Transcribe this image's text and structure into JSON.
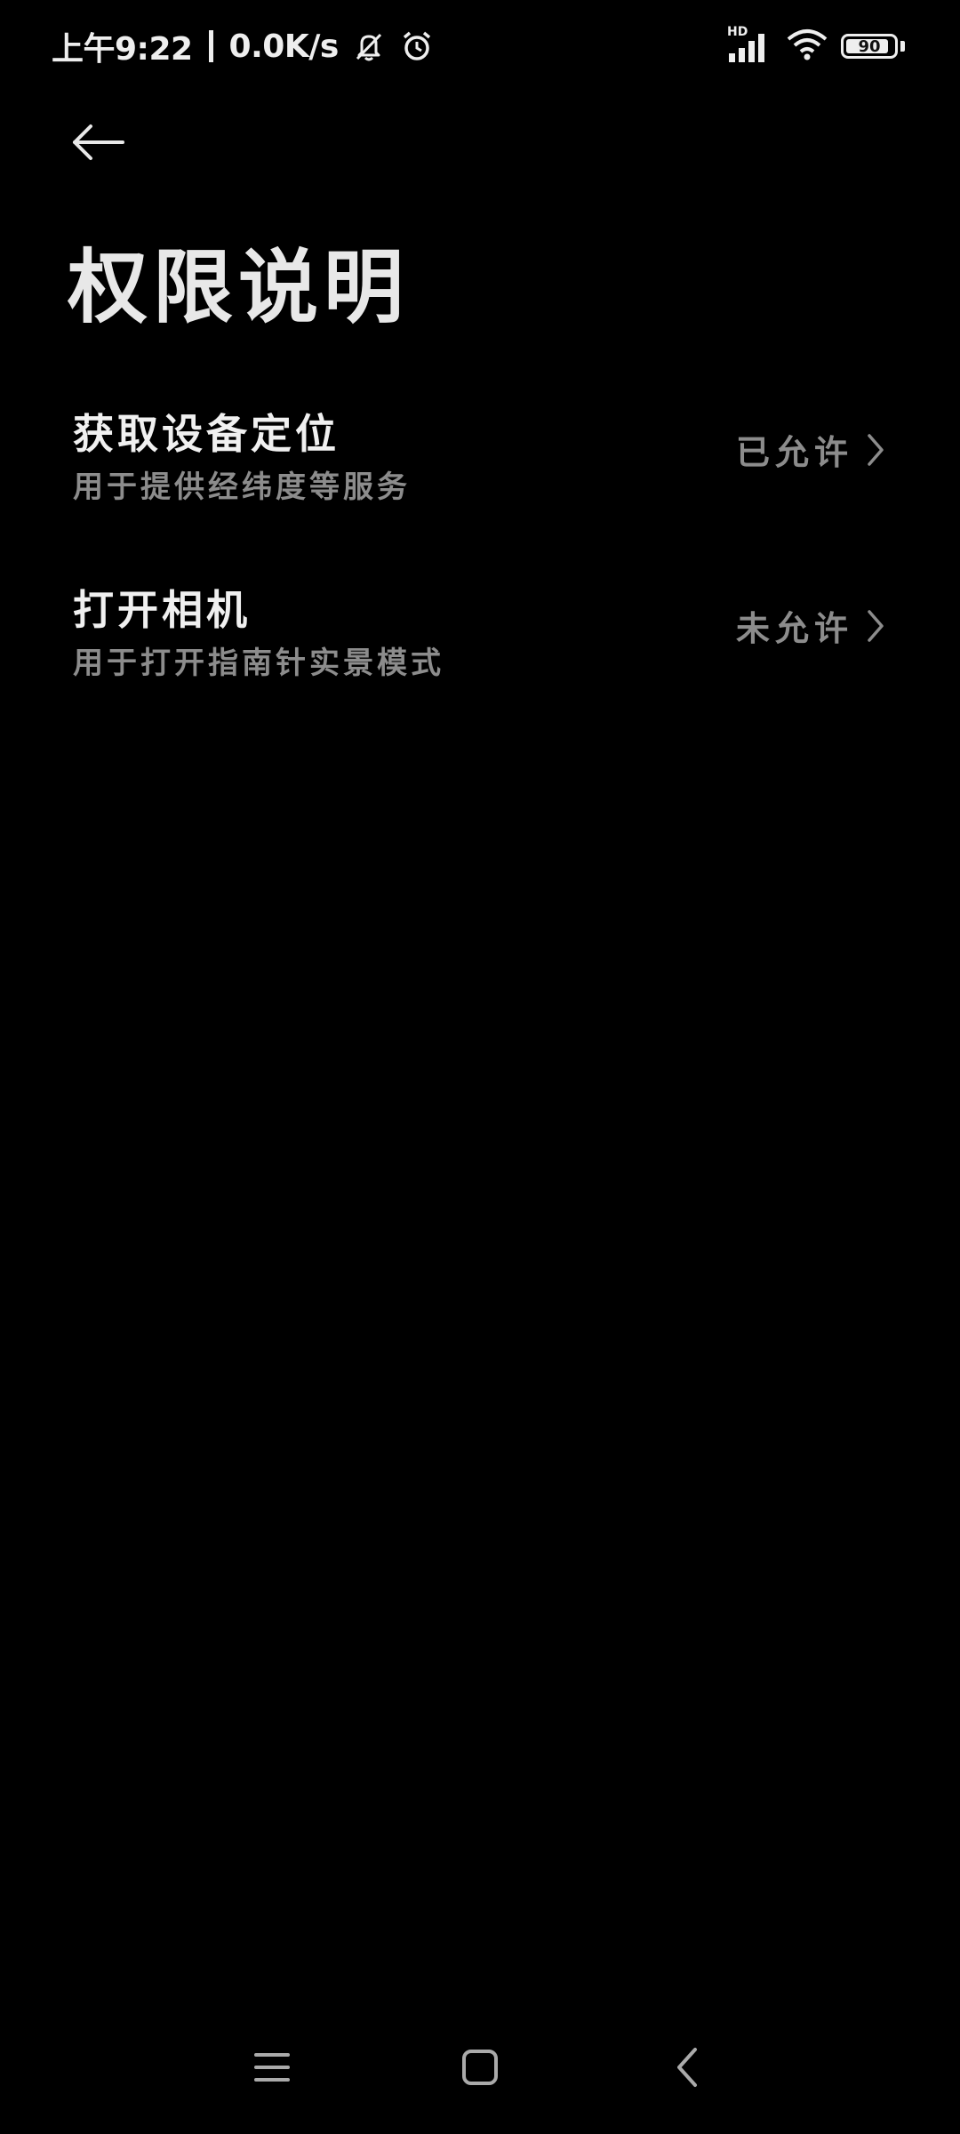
{
  "status_bar": {
    "time": "上午9:22",
    "network_speed": "0.0K/s",
    "signal_label": "HD",
    "battery_level": "90",
    "battery_fraction": 0.9,
    "icons": [
      "mute-icon",
      "alarm-icon",
      "signal-icon",
      "wifi-icon",
      "battery-icon"
    ]
  },
  "header": {
    "back_icon": "arrow-left-icon",
    "title": "权限说明"
  },
  "permissions": [
    {
      "title": "获取设备定位",
      "description": "用于提供经纬度等服务",
      "status": "已允许"
    },
    {
      "title": "打开相机",
      "description": "用于打开指南针实景模式",
      "status": "未允许"
    }
  ],
  "nav_bar": {
    "icons": [
      "menu-icon",
      "home-icon",
      "back-icon"
    ]
  },
  "colors": {
    "background": "#000000",
    "primary_text": "#f0f0f0",
    "secondary_text": "#8c8c8c"
  }
}
